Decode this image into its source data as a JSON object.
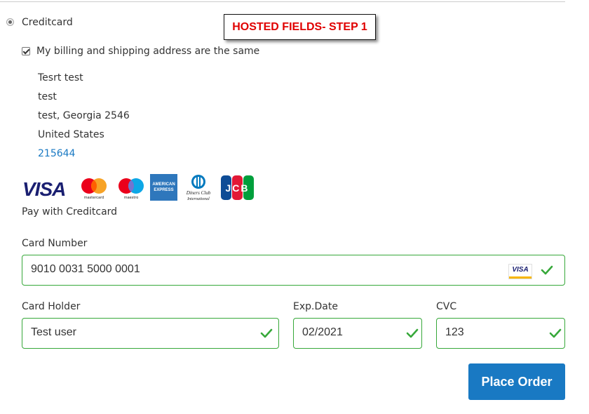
{
  "payment_method": {
    "label": "Creditcard",
    "selected": true
  },
  "callout": {
    "text": "HOSTED FIELDS- STEP 1",
    "color": "#e00000"
  },
  "billing": {
    "same_as_shipping_label": "My billing and shipping address are the same",
    "checked": true,
    "address": {
      "name": "Tesrt test",
      "street": "test",
      "city_region_zip": "test, Georgia 2546",
      "country": "United States",
      "phone": "215644"
    }
  },
  "card_logos": {
    "visa": "VISA",
    "mastercard": "mastercard",
    "maestro": "maestro",
    "amex_line1": "AMERICAN",
    "amex_line2": "EXPRESS",
    "diners_line1": "Diners Club",
    "diners_line2": "International",
    "jcb": "JCB"
  },
  "pay_with_label": "Pay with Creditcard",
  "fields": {
    "card_number": {
      "label": "Card Number",
      "value": "9010 0031 5000 0001",
      "brand_badge": "VISA",
      "valid": true
    },
    "card_holder": {
      "label": "Card Holder",
      "value": "Test user",
      "valid": true
    },
    "exp_date": {
      "label": "Exp.Date",
      "value": "02/2021",
      "valid": true
    },
    "cvc": {
      "label": "CVC",
      "value": "123",
      "valid": true
    }
  },
  "place_order_label": "Place Order",
  "colors": {
    "accent": "#1979c3",
    "valid_green": "#37a83a"
  }
}
